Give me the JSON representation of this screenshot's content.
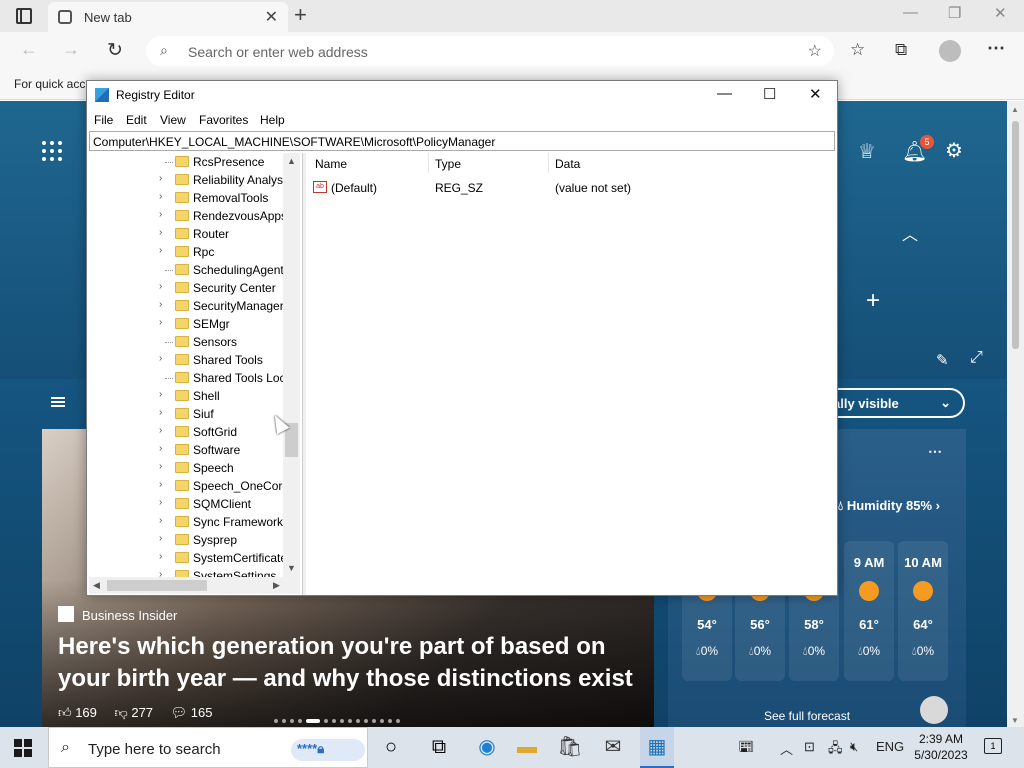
{
  "browser": {
    "tab_title": "New tab",
    "address_placeholder": "Search or enter web address",
    "favbar_text": "For quick acc"
  },
  "page": {
    "notification_count": "5",
    "visibility_label": "ally visible",
    "article": {
      "source": "Business Insider",
      "headline": "Here's which generation you're part of based on your birth year — and why those distinctions exist",
      "likes": "169",
      "dislikes": "277",
      "comments": "165"
    },
    "weather": {
      "humidity": "Humidity 85%",
      "hours": [
        {
          "label": "",
          "temp": "54°",
          "rain": "0%"
        },
        {
          "label": "",
          "temp": "56°",
          "rain": "0%"
        },
        {
          "label": "",
          "temp": "58°",
          "rain": "0%"
        },
        {
          "label": "9 AM",
          "temp": "61°",
          "rain": "0%"
        },
        {
          "label": "10 AM",
          "temp": "64°",
          "rain": "0%"
        }
      ],
      "forecast_button": "See full forecast"
    }
  },
  "regedit": {
    "title": "Registry Editor",
    "menu": [
      "File",
      "Edit",
      "View",
      "Favorites",
      "Help"
    ],
    "path": "Computer\\HKEY_LOCAL_MACHINE\\SOFTWARE\\Microsoft\\PolicyManager",
    "tree": [
      {
        "label": "RcsPresence",
        "expandable": false
      },
      {
        "label": "Reliability Analysi",
        "expandable": true
      },
      {
        "label": "RemovalTools",
        "expandable": true
      },
      {
        "label": "RendezvousApps",
        "expandable": true
      },
      {
        "label": "Router",
        "expandable": true
      },
      {
        "label": "Rpc",
        "expandable": true
      },
      {
        "label": "SchedulingAgent",
        "expandable": false
      },
      {
        "label": "Security Center",
        "expandable": true
      },
      {
        "label": "SecurityManager",
        "expandable": true
      },
      {
        "label": "SEMgr",
        "expandable": true
      },
      {
        "label": "Sensors",
        "expandable": false
      },
      {
        "label": "Shared Tools",
        "expandable": true
      },
      {
        "label": "Shared Tools Loca",
        "expandable": false
      },
      {
        "label": "Shell",
        "expandable": true
      },
      {
        "label": "Siuf",
        "expandable": true
      },
      {
        "label": "SoftGrid",
        "expandable": true
      },
      {
        "label": "Software",
        "expandable": true
      },
      {
        "label": "Speech",
        "expandable": true
      },
      {
        "label": "Speech_OneCore",
        "expandable": true
      },
      {
        "label": "SQMClient",
        "expandable": true
      },
      {
        "label": "Sync Framework",
        "expandable": true
      },
      {
        "label": "Sysprep",
        "expandable": true
      },
      {
        "label": "SystemCertificate",
        "expandable": true
      },
      {
        "label": "SystemSettings",
        "expandable": true
      }
    ],
    "columns": {
      "name": "Name",
      "type": "Type",
      "data": "Data"
    },
    "values": [
      {
        "name": "(Default)",
        "type": "REG_SZ",
        "data": "(value not set)"
      }
    ]
  },
  "taskbar": {
    "search_placeholder": "Type here to search",
    "language": "ENG",
    "time": "2:39 AM",
    "date": "5/30/2023",
    "notification_count": "1"
  }
}
